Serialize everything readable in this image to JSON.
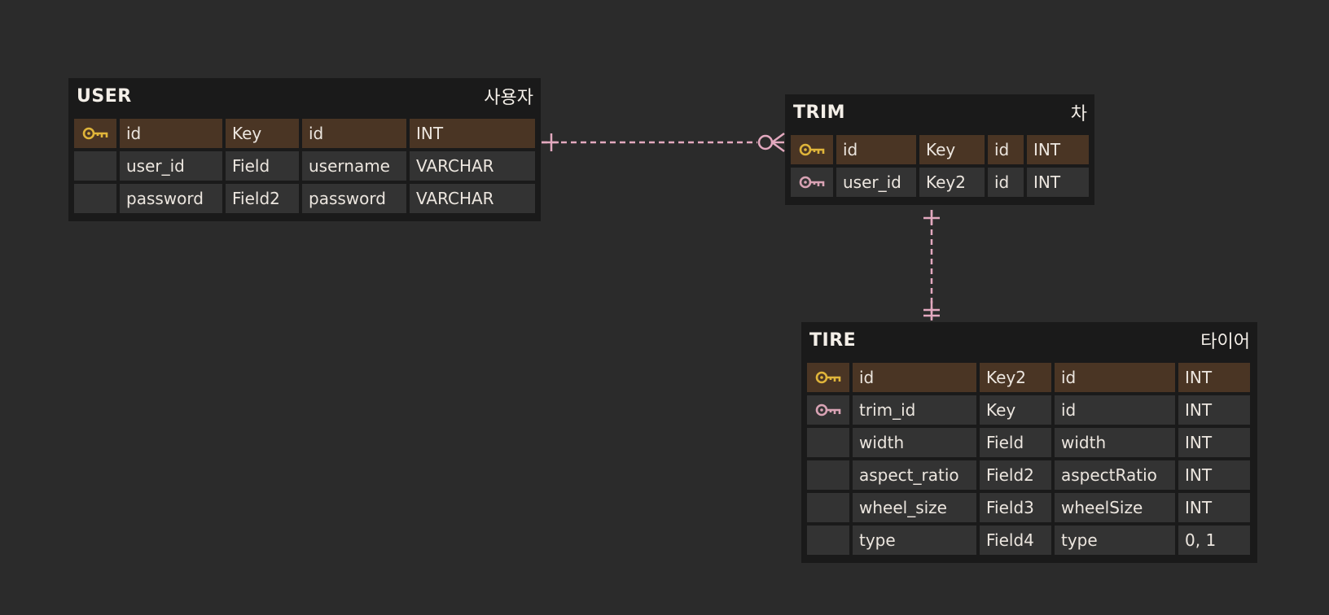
{
  "colors": {
    "background": "#2b2b2b",
    "entity_bg": "#1a1a1a",
    "cell_bg": "#333333",
    "pk_row_bg": "#4a3524",
    "pk_key": "#e0b53a",
    "fk_key": "#d9a3b4",
    "relation_line": "#e3a9bf"
  },
  "entities": {
    "user": {
      "name": "USER",
      "label": "사용자",
      "rows": [
        {
          "key": "pk-key-icon",
          "col1": "id",
          "col2": "Key",
          "col3": "id",
          "col4": "INT"
        },
        {
          "key": "",
          "col1": "user_id",
          "col2": "Field",
          "col3": "username",
          "col4": "VARCHAR"
        },
        {
          "key": "",
          "col1": "password",
          "col2": "Field2",
          "col3": "password",
          "col4": "VARCHAR"
        }
      ]
    },
    "trim": {
      "name": "TRIM",
      "label": "차",
      "rows": [
        {
          "key": "pk-key-icon",
          "col1": "id",
          "col2": "Key",
          "col3": "id",
          "col4": "INT"
        },
        {
          "key": "fk-key-icon",
          "col1": "user_id",
          "col2": "Key2",
          "col3": "id",
          "col4": "INT"
        }
      ]
    },
    "tire": {
      "name": "TIRE",
      "label": "타이어",
      "rows": [
        {
          "key": "pk-key-icon",
          "col1": "id",
          "col2": "Key2",
          "col3": "id",
          "col4": "INT"
        },
        {
          "key": "fk-key-icon",
          "col1": "trim_id",
          "col2": "Key",
          "col3": "id",
          "col4": "INT"
        },
        {
          "key": "",
          "col1": "width",
          "col2": "Field",
          "col3": "width",
          "col4": "INT"
        },
        {
          "key": "",
          "col1": "aspect_ratio",
          "col2": "Field2",
          "col3": "aspectRatio",
          "col4": "INT"
        },
        {
          "key": "",
          "col1": "wheel_size",
          "col2": "Field3",
          "col3": "wheelSize",
          "col4": "INT"
        },
        {
          "key": "",
          "col1": "type",
          "col2": "Field4",
          "col3": "type",
          "col4": "0, 1"
        }
      ]
    }
  },
  "relations": [
    {
      "from": "USER",
      "to": "TRIM",
      "from_cardinality": "one",
      "to_cardinality": "zero-or-many",
      "style": "dashed"
    },
    {
      "from": "TRIM",
      "to": "TIRE",
      "from_cardinality": "one",
      "to_cardinality": "one-and-only-one",
      "style": "dashed"
    }
  ]
}
